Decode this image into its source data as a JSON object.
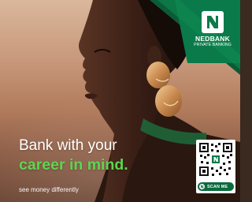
{
  "brand": {
    "name": "NEDBANK",
    "subtitle": "PRIVATE BANKING",
    "logo_icon": "nedbank-n-logo-icon",
    "colors": {
      "green": "#0b7a4a",
      "dark_green": "#0b5b36",
      "headline_accent": "#5cd64e"
    }
  },
  "headline": {
    "line1": "Bank with your",
    "line2": "career in mind."
  },
  "tagline": "see money differently",
  "qr": {
    "icon": "qr-code-icon",
    "button_label": "SCAN ME",
    "button_icon": "nedbank-n-small-icon"
  },
  "image": {
    "subject": "portrait-photo",
    "earring_icon": "gold-earring-icon"
  }
}
